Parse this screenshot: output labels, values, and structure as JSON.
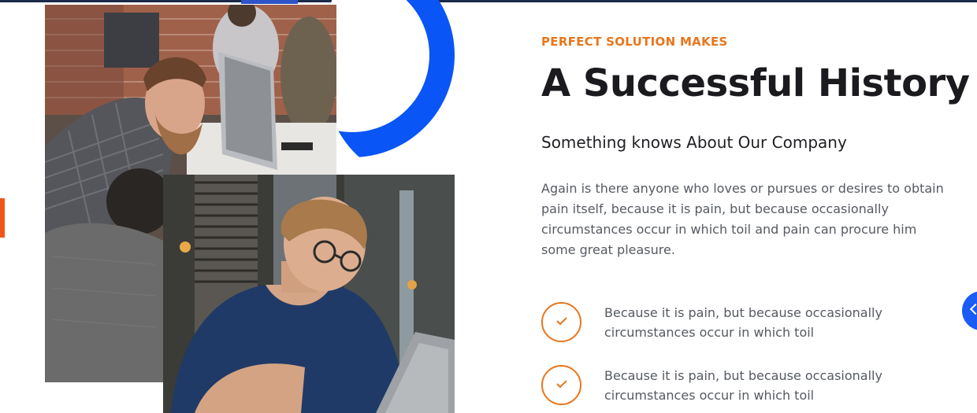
{
  "about": {
    "eyebrow": "PERFECT SOLUTION MAKES",
    "title": "A Successful History",
    "subtitle": "Something knows About Our Company",
    "paragraph": "Again is there anyone who loves or pursues or desires to obtain pain itself, because it is pain, but because occasionally circumstances occur in which toil and pain can procure him some great pleasure.",
    "checklist": [
      {
        "text": "Because it is pain, but because occasionally circumstances occur in which toil",
        "icon": "check-icon"
      },
      {
        "text": "Because it is pain, but because occasionally circumstances occur in which toil",
        "icon": "check-icon"
      }
    ]
  },
  "images": [
    {
      "name": "team-at-computers-photo"
    },
    {
      "name": "man-with-laptop-photo"
    }
  ],
  "colors": {
    "accent_orange": "#e8761d",
    "accent_blue": "#0a55f5",
    "heading": "#1b1b1f",
    "body_text": "#555a62",
    "left_accent": "#f0561a"
  },
  "floating_button": {
    "icon": "chevron-left-icon"
  }
}
